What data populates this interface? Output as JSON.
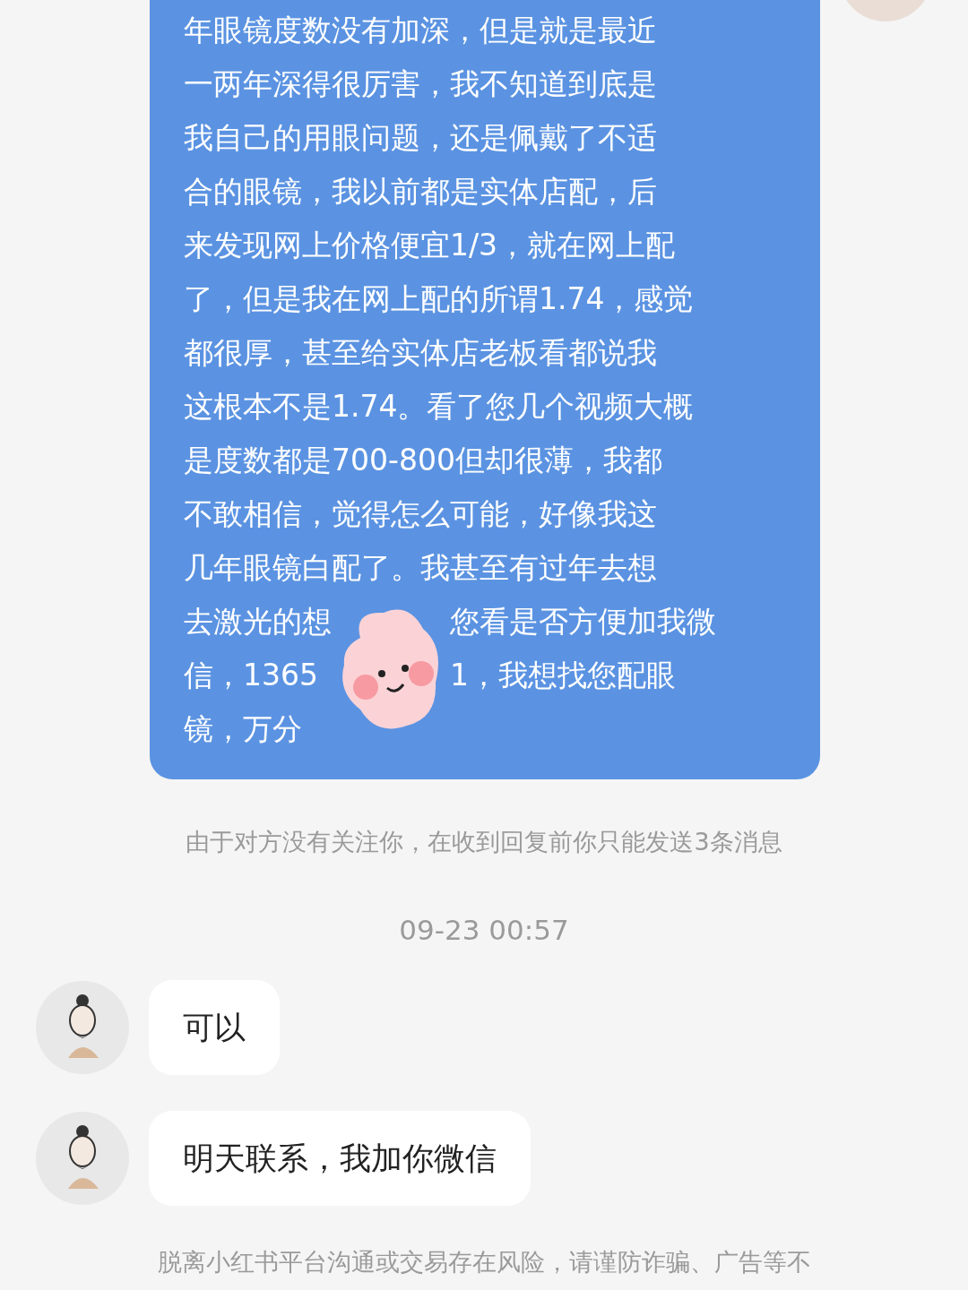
{
  "incoming": {
    "lines": [
      "年眼镜度数没有加深，但是就是最近",
      "一两年深得很厉害，我不知道到底是",
      "我自己的用眼问题，还是佩戴了不适",
      "合的眼镜，我以前都是实体店配，后",
      "来发现网上价格便宜1/3，就在网上配",
      "了，但是我在网上配的所谓1.74，感觉",
      "都很厚，甚至给实体店老板看都说我",
      "这根本不是1.74。看了您几个视频大概",
      "是度数都是700-800但却很薄，我都",
      "不敢相信，觉得怎么可能，好像我这",
      "几年眼镜白配了。我甚至有过年去想"
    ],
    "covered_left": [
      "去激光的想",
      "信，1365",
      "镜，万分"
    ],
    "covered_right": [
      "您看是否方便加我微",
      "1，我想找您配眼"
    ]
  },
  "notice": "由于对方没有关注你，在收到回复前你只能发送3条消息",
  "timestamp": "09-23 00:57",
  "replies": [
    {
      "text": "可以"
    },
    {
      "text": "明天联系，我加你微信"
    }
  ],
  "footer": "脱离小红书平台沟通或交易存在风险，请谨防诈骗、广告等不"
}
